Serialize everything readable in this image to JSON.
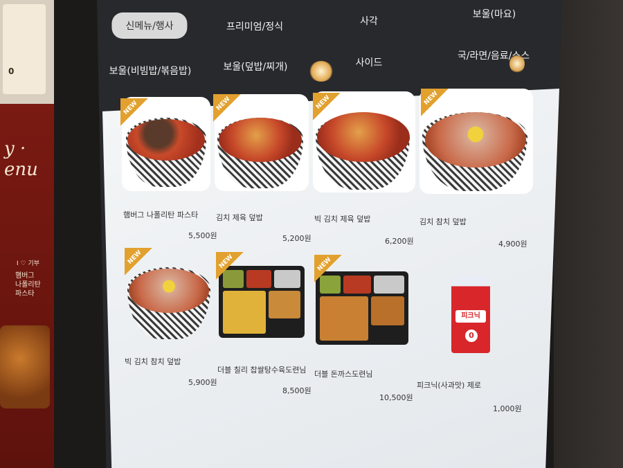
{
  "poster": {
    "price_fragment": "0",
    "headline_fragment": "y ·\nenu",
    "item_label": "햄버그\n나폴리탄\n파스타",
    "tag": "I ♡ 기부"
  },
  "tabs": [
    {
      "label": "신메뉴/행사",
      "active": true
    },
    {
      "label": "프리미엄/정식",
      "active": false
    },
    {
      "label": "사각",
      "active": false
    },
    {
      "label": "보울(마요)",
      "active": false
    },
    {
      "label": "보울(비빔밥/볶음밥)",
      "active": false
    },
    {
      "label": "보울(덮밥/찌개)",
      "active": false
    },
    {
      "label": "사이드",
      "active": false
    },
    {
      "label": "국/라면/음료/소스",
      "active": false
    }
  ],
  "badge_text": "NEW",
  "items": [
    {
      "name": "햄버그 나폴리탄 파스타",
      "price": "5,500원",
      "new": true
    },
    {
      "name": "김치 제육 덮밥",
      "price": "5,200원",
      "new": true
    },
    {
      "name": "빅 김치 제육 덮밥",
      "price": "6,200원",
      "new": true
    },
    {
      "name": "김치 참치 덮밥",
      "price": "4,900원",
      "new": true
    },
    {
      "name": "빅 김치 참치 덮밥",
      "price": "5,900원",
      "new": true
    },
    {
      "name": "더블 칠리 찹쌀탕수육도련님",
      "price": "8,500원",
      "new": true
    },
    {
      "name": "더블 돈까스도련님",
      "price": "10,500원",
      "new": true
    },
    {
      "name": "피크닉(사과맛) 제로",
      "price": "1,000원",
      "new": false
    }
  ],
  "juice": {
    "logo": "피크닉",
    "zero": "0"
  },
  "colors": {
    "badge": "#e2a12e",
    "menu_bg": "#eef1f3",
    "screen_bg": "#27292c",
    "active_tab": "#d9d9d9"
  }
}
